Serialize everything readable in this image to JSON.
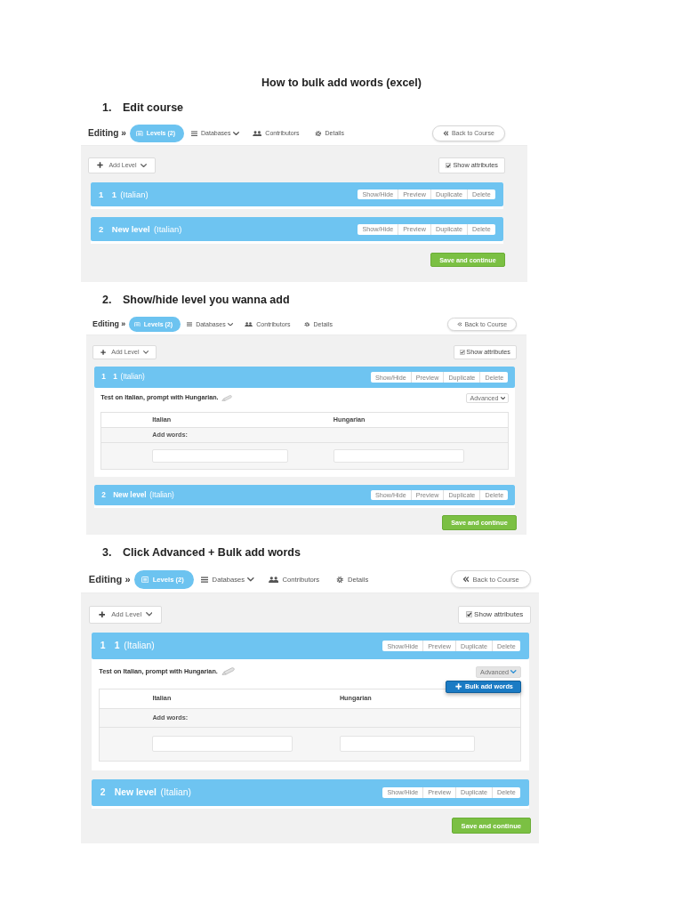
{
  "title": "How to bulk add words (excel)",
  "steps": [
    {
      "number": "1.",
      "heading": "Edit course",
      "editor": {
        "breadcrumb": "Editing »",
        "tabs": [
          {
            "label": "Levels (2)",
            "selected": true,
            "dropdown": false
          },
          {
            "label": "Databases",
            "selected": false,
            "dropdown": true
          },
          {
            "label": "Contributors",
            "selected": false,
            "dropdown": false
          },
          {
            "label": "Details",
            "selected": false,
            "dropdown": false
          }
        ],
        "back_button": "Back to Course",
        "add_level_button": "Add Level",
        "show_attributes": {
          "label": "Show attributes",
          "checked": true
        },
        "levels": [
          {
            "number": "1",
            "name": "1",
            "language": "(Italian)",
            "expanded": false,
            "actions": [
              "Show/Hide",
              "Preview",
              "Duplicate",
              "Delete"
            ]
          },
          {
            "number": "2",
            "name": "New level",
            "language": "(Italian)",
            "expanded": false,
            "actions": [
              "Show/Hide",
              "Preview",
              "Duplicate",
              "Delete"
            ]
          }
        ],
        "save_button": "Save and continue"
      }
    },
    {
      "number": "2.",
      "heading": "Show/hide level you wanna add",
      "editor": {
        "breadcrumb": "Editing »",
        "tabs": [
          {
            "label": "Levels (2)",
            "selected": true,
            "dropdown": false
          },
          {
            "label": "Databases",
            "selected": false,
            "dropdown": true
          },
          {
            "label": "Contributors",
            "selected": false,
            "dropdown": false
          },
          {
            "label": "Details",
            "selected": false,
            "dropdown": false
          }
        ],
        "back_button": "Back to Course",
        "add_level_button": "Add Level",
        "show_attributes": {
          "label": "Show attributes",
          "checked": true
        },
        "levels": [
          {
            "number": "1",
            "name": "1",
            "language": "(Italian)",
            "expanded": true,
            "actions": [
              "Show/Hide",
              "Preview",
              "Duplicate",
              "Delete"
            ],
            "description": "Test on Italian, prompt with Hungarian.",
            "advanced": {
              "label": "Advanced",
              "open": false
            },
            "columns": [
              "Italian",
              "Hungarian"
            ],
            "add_words_label": "Add words:"
          },
          {
            "number": "2",
            "name": "New level",
            "language": "(Italian)",
            "expanded": false,
            "actions": [
              "Show/Hide",
              "Preview",
              "Duplicate",
              "Delete"
            ]
          }
        ],
        "save_button": "Save and continue"
      }
    },
    {
      "number": "3.",
      "heading": "Click Advanced + Bulk add words",
      "editor": {
        "breadcrumb": "Editing »",
        "tabs": [
          {
            "label": "Levels (2)",
            "selected": true,
            "dropdown": false
          },
          {
            "label": "Databases",
            "selected": false,
            "dropdown": true
          },
          {
            "label": "Contributors",
            "selected": false,
            "dropdown": false
          },
          {
            "label": "Details",
            "selected": false,
            "dropdown": false
          }
        ],
        "back_button": "Back to Course",
        "add_level_button": "Add Level",
        "show_attributes": {
          "label": "Show attributes",
          "checked": true
        },
        "levels": [
          {
            "number": "1",
            "name": "1",
            "language": "(Italian)",
            "expanded": true,
            "actions": [
              "Show/Hide",
              "Preview",
              "Duplicate",
              "Delete"
            ],
            "description": "Test on Italian, prompt with Hungarian.",
            "advanced": {
              "label": "Advanced",
              "open": true,
              "menu": [
                "Bulk add words"
              ]
            },
            "columns": [
              "Italian",
              "Hungarian"
            ],
            "add_words_label": "Add words:"
          },
          {
            "number": "2",
            "name": "New level",
            "language": "(Italian)",
            "expanded": false,
            "actions": [
              "Show/Hide",
              "Preview",
              "Duplicate",
              "Delete"
            ]
          }
        ],
        "save_button": "Save and continue"
      }
    }
  ]
}
